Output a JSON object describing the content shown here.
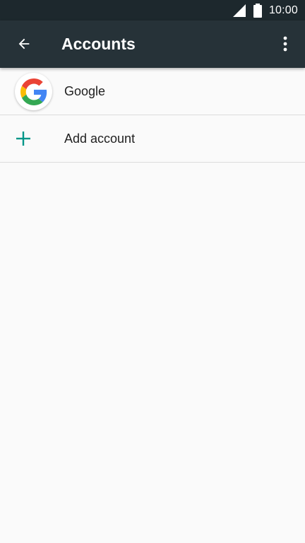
{
  "status_bar": {
    "time": "10:00",
    "signal_icon": "cellular-signal-icon",
    "battery_icon": "battery-full-icon"
  },
  "toolbar": {
    "title": "Accounts",
    "back_icon": "arrow-back-icon",
    "overflow_icon": "more-vert-icon"
  },
  "accounts": {
    "items": [
      {
        "label": "Google",
        "icon": "google-logo-icon"
      },
      {
        "label": "Add account",
        "icon": "plus-icon"
      }
    ]
  },
  "colors": {
    "status_bar": "#1d282d",
    "toolbar": "#263238",
    "background": "#fafafa",
    "accent": "#009688",
    "google_blue": "#4285F4",
    "google_red": "#EA4335",
    "google_yellow": "#FBBC05",
    "google_green": "#34A853"
  }
}
